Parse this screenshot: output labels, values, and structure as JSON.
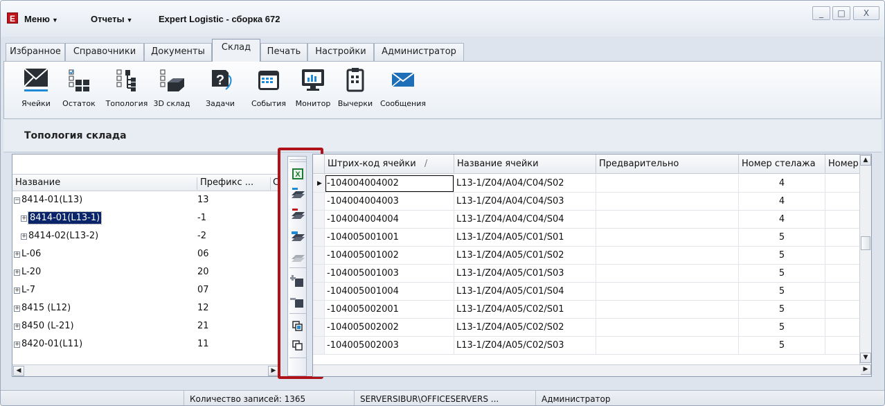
{
  "titlebar": {
    "logo": "E",
    "menu": [
      {
        "label": "Меню"
      },
      {
        "label": "Отчеты"
      }
    ],
    "title": "Expert Logistic - сборка 672",
    "buttons": {
      "minimize": "_",
      "maximize": "□",
      "close": "X"
    }
  },
  "tabs": [
    {
      "label": "Избранное"
    },
    {
      "label": "Справочники"
    },
    {
      "label": "Документы"
    },
    {
      "label": "Склад"
    },
    {
      "label": "Печать"
    },
    {
      "label": "Настройки"
    },
    {
      "label": "Администратор"
    }
  ],
  "active_tab": "Склад",
  "ribbon": [
    {
      "label": "Ячейки",
      "icon": "envelope-cells-icon"
    },
    {
      "label": "Остаток",
      "icon": "stock-checklist-icon"
    },
    {
      "label": "Топология",
      "icon": "topology-tree-icon"
    },
    {
      "label": "3D склад",
      "icon": "warehouse-3d-icon"
    },
    {
      "label": "Задачи",
      "icon": "tasks-question-icon"
    },
    {
      "label": "События",
      "icon": "calendar-icon"
    },
    {
      "label": "Монитор",
      "icon": "monitor-chart-icon"
    },
    {
      "label": "Вычерки",
      "icon": "clipboard-icon"
    },
    {
      "label": "Сообщения",
      "icon": "mail-icon"
    }
  ],
  "section_title": "Топология склада",
  "tree": {
    "columns": {
      "name": "Название",
      "prefix": "Префикс ...",
      "extra": "С"
    },
    "rows": [
      {
        "name": "8414-01(L13)",
        "prefix": "13",
        "level": 0,
        "expander": "⊟",
        "selected": false
      },
      {
        "name": "8414-01(L13-1)",
        "prefix": "-1",
        "level": 1,
        "expander": "⊞",
        "selected": true
      },
      {
        "name": "8414-02(L13-2)",
        "prefix": "-2",
        "level": 1,
        "expander": "⊞",
        "selected": false
      },
      {
        "name": "L-06",
        "prefix": "06",
        "level": 0,
        "expander": "⊞",
        "selected": false
      },
      {
        "name": "L-20",
        "prefix": "20",
        "level": 0,
        "expander": "⊞",
        "selected": false
      },
      {
        "name": "L-7",
        "prefix": "07",
        "level": 0,
        "expander": "⊞",
        "selected": false
      },
      {
        "name": "8415 (L12)",
        "prefix": "12",
        "level": 0,
        "expander": "⊞",
        "selected": false
      },
      {
        "name": "8450 (L-21)",
        "prefix": "21",
        "level": 0,
        "expander": "⊞",
        "selected": false
      },
      {
        "name": "8420-01(L11)",
        "prefix": "11",
        "level": 0,
        "expander": "⊞",
        "selected": false
      }
    ]
  },
  "vtoolbar": [
    {
      "name": "excel-export-icon"
    },
    {
      "name": "add-row-icon"
    },
    {
      "name": "delete-row-icon"
    },
    {
      "name": "add-rows-blue-icon"
    },
    {
      "name": "edit-row-disabled-icon"
    },
    {
      "name": "add-cell-icon"
    },
    {
      "name": "remove-cell-icon"
    },
    {
      "name": "copy-icon"
    },
    {
      "name": "paste-icon"
    }
  ],
  "grid": {
    "columns": [
      {
        "label": "Штрих-код ячейки",
        "sort": "/"
      },
      {
        "label": "Название ячейки"
      },
      {
        "label": "Предварительно"
      },
      {
        "label": "Номер стелажа"
      },
      {
        "label": "Номер"
      }
    ],
    "rows": [
      {
        "barcode": "-104004004002",
        "name": "L13-1/Z04/A04/C04/S02",
        "pre": "",
        "rack": "4"
      },
      {
        "barcode": "-104004004003",
        "name": "L13-1/Z04/A04/C04/S03",
        "pre": "",
        "rack": "4"
      },
      {
        "barcode": "-104004004004",
        "name": "L13-1/Z04/A04/C04/S04",
        "pre": "",
        "rack": "4"
      },
      {
        "barcode": "-104005001001",
        "name": "L13-1/Z04/A05/C01/S01",
        "pre": "",
        "rack": "5"
      },
      {
        "barcode": "-104005001002",
        "name": "L13-1/Z04/A05/C01/S02",
        "pre": "",
        "rack": "5"
      },
      {
        "barcode": "-104005001003",
        "name": "L13-1/Z04/A05/C01/S03",
        "pre": "",
        "rack": "5"
      },
      {
        "barcode": "-104005001004",
        "name": "L13-1/Z04/A05/C01/S04",
        "pre": "",
        "rack": "5"
      },
      {
        "barcode": "-104005002001",
        "name": "L13-1/Z04/A05/C02/S01",
        "pre": "",
        "rack": "5"
      },
      {
        "barcode": "-104005002002",
        "name": "L13-1/Z04/A05/C02/S02",
        "pre": "",
        "rack": "5"
      },
      {
        "barcode": "-104005002003",
        "name": "L13-1/Z04/A05/C02/S03",
        "pre": "",
        "rack": "5"
      }
    ]
  },
  "status": {
    "records": "Количество записей: 1365",
    "server": "SERVERSIBUR\\OFFICESERVERS ...",
    "user": "Администратор"
  },
  "colors": {
    "highlight": "#b0121a",
    "selection": "#0a246a",
    "accent": "#1f8ad6"
  }
}
